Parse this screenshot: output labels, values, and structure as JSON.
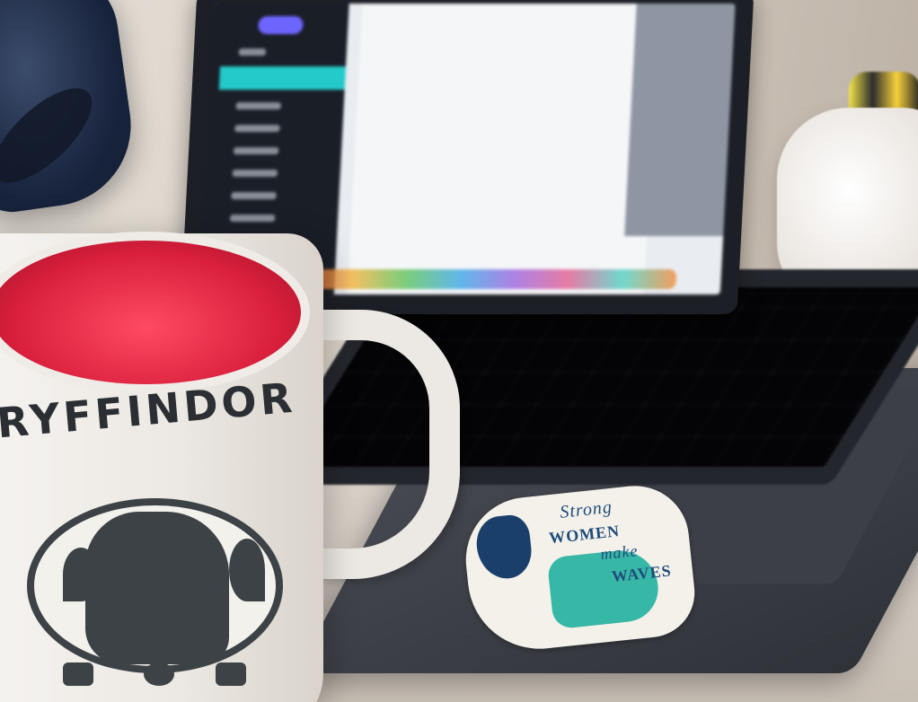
{
  "photo": {
    "mug_text": "RYFFINDOR",
    "sticker_lines": [
      "Strong",
      "WOMEN",
      "make",
      "WAVES"
    ]
  }
}
